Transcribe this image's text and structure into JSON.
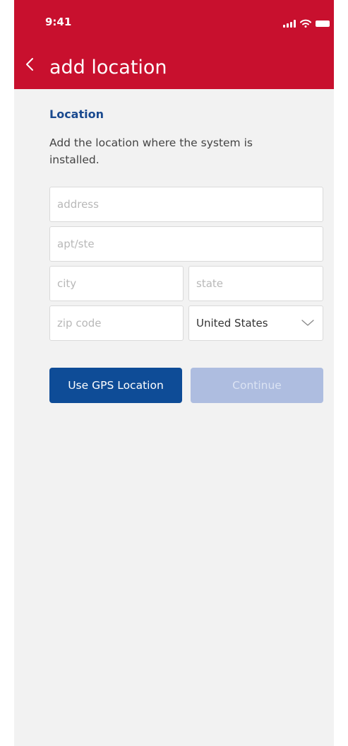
{
  "status_bar": {
    "time": "9:41",
    "icons": [
      "signal-icon",
      "wifi-icon",
      "battery-icon"
    ]
  },
  "header": {
    "back_icon": "chevron-left-icon",
    "title": "add location",
    "background_color": "#c8102e"
  },
  "form": {
    "section_title": "Location",
    "description": "Add the location where the system is installed.",
    "fields": {
      "address": {
        "placeholder": "address",
        "value": ""
      },
      "apt": {
        "placeholder": "apt/ste",
        "value": ""
      },
      "city": {
        "placeholder": "city",
        "value": ""
      },
      "state": {
        "placeholder": "state",
        "value": ""
      },
      "zip": {
        "placeholder": "zip code",
        "value": ""
      },
      "country": {
        "selected": "United States",
        "icon": "chevron-down-icon"
      }
    }
  },
  "buttons": {
    "gps_label": "Use GPS Location",
    "continue_label": "Continue",
    "primary_color": "#0e4c97",
    "disabled_color": "#aebde0"
  }
}
